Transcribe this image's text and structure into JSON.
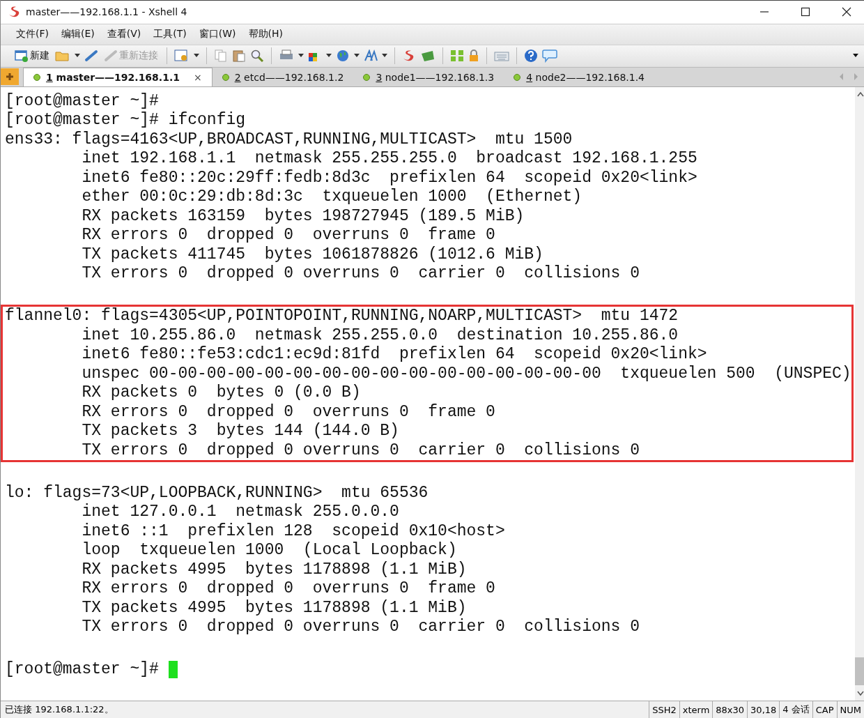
{
  "window": {
    "title": "master——192.168.1.1 - Xshell 4"
  },
  "menu": [
    "文件(F)",
    "编辑(E)",
    "查看(V)",
    "工具(T)",
    "窗口(W)",
    "帮助(H)"
  ],
  "toolbar": {
    "new_label": "新建",
    "reconnect": {
      "label": "重新连接",
      "disabled": true
    }
  },
  "tabs": [
    {
      "number": "1",
      "label": "master——192.168.1.1",
      "selected": true,
      "close": "×"
    },
    {
      "number": "2",
      "label": "etcd——192.168.1.2",
      "selected": false
    },
    {
      "number": "3",
      "label": "node1——192.168.1.3",
      "selected": false
    },
    {
      "number": "4",
      "label": "node2——192.168.1.4",
      "selected": false
    }
  ],
  "terminal": {
    "cursor": true,
    "blocks": [
      {
        "highlighted": false,
        "lines": [
          "[root@master ~]#",
          "[root@master ~]# ifconfig",
          "ens33: flags=4163<UP,BROADCAST,RUNNING,MULTICAST>  mtu 1500",
          "        inet 192.168.1.1  netmask 255.255.255.0  broadcast 192.168.1.255",
          "        inet6 fe80::20c:29ff:fedb:8d3c  prefixlen 64  scopeid 0x20<link>",
          "        ether 00:0c:29:db:8d:3c  txqueuelen 1000  (Ethernet)",
          "        RX packets 163159  bytes 198727945 (189.5 MiB)",
          "        RX errors 0  dropped 0  overruns 0  frame 0",
          "        TX packets 411745  bytes 1061878826 (1012.6 MiB)",
          "        TX errors 0  dropped 0 overruns 0  carrier 0  collisions 0"
        ]
      },
      {
        "highlighted": true,
        "lines": [
          "flannel0: flags=4305<UP,POINTOPOINT,RUNNING,NOARP,MULTICAST>  mtu 1472",
          "        inet 10.255.86.0  netmask 255.255.0.0  destination 10.255.86.0",
          "        inet6 fe80::fe53:cdc1:ec9d:81fd  prefixlen 64  scopeid 0x20<link>",
          "        unspec 00-00-00-00-00-00-00-00-00-00-00-00-00-00-00-00  txqueuelen 500  (UNSPEC)",
          "        RX packets 0  bytes 0 (0.0 B)",
          "        RX errors 0  dropped 0  overruns 0  frame 0",
          "        TX packets 3  bytes 144 (144.0 B)",
          "        TX errors 0  dropped 0 overruns 0  carrier 0  collisions 0"
        ]
      },
      {
        "highlighted": false,
        "lines": [
          "lo: flags=73<UP,LOOPBACK,RUNNING>  mtu 65536",
          "        inet 127.0.0.1  netmask 255.0.0.0",
          "        inet6 ::1  prefixlen 128  scopeid 0x10<host>",
          "        loop  txqueuelen 1000  (Local Loopback)",
          "        RX packets 4995  bytes 1178898 (1.1 MiB)",
          "        RX errors 0  dropped 0  overruns 0  frame 0",
          "        TX packets 4995  bytes 1178898 (1.1 MiB)",
          "        TX errors 0  dropped 0 overruns 0  carrier 0  collisions 0"
        ]
      },
      {
        "highlighted": false,
        "lines": [
          "[root@master ~]# "
        ]
      }
    ]
  },
  "status_bar": {
    "message": "已连接 192.168.1.1:22。",
    "fields": [
      "SSH2",
      "xterm",
      "88x30",
      "30,18",
      "4 会话",
      "CAP",
      "NUM"
    ]
  }
}
